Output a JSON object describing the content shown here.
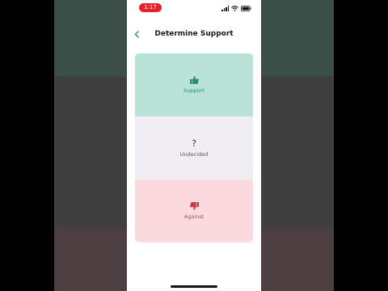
{
  "status_bar": {
    "time": "1:17"
  },
  "nav": {
    "title": "Determine Support"
  },
  "options": [
    {
      "label": "Support",
      "icon": "thumbs-up-icon",
      "color": "#2e8b72",
      "background": "#b8e3d6"
    },
    {
      "label": "Undecided",
      "icon": "question-icon",
      "glyph": "?",
      "color": "#555555",
      "background": "#f0eef3"
    },
    {
      "label": "Against",
      "icon": "thumbs-down-icon",
      "color": "#c83c54",
      "background": "#fbdbe0"
    }
  ],
  "colors": {
    "accent": "#2e8b72",
    "time_pill": "#e8202a"
  }
}
